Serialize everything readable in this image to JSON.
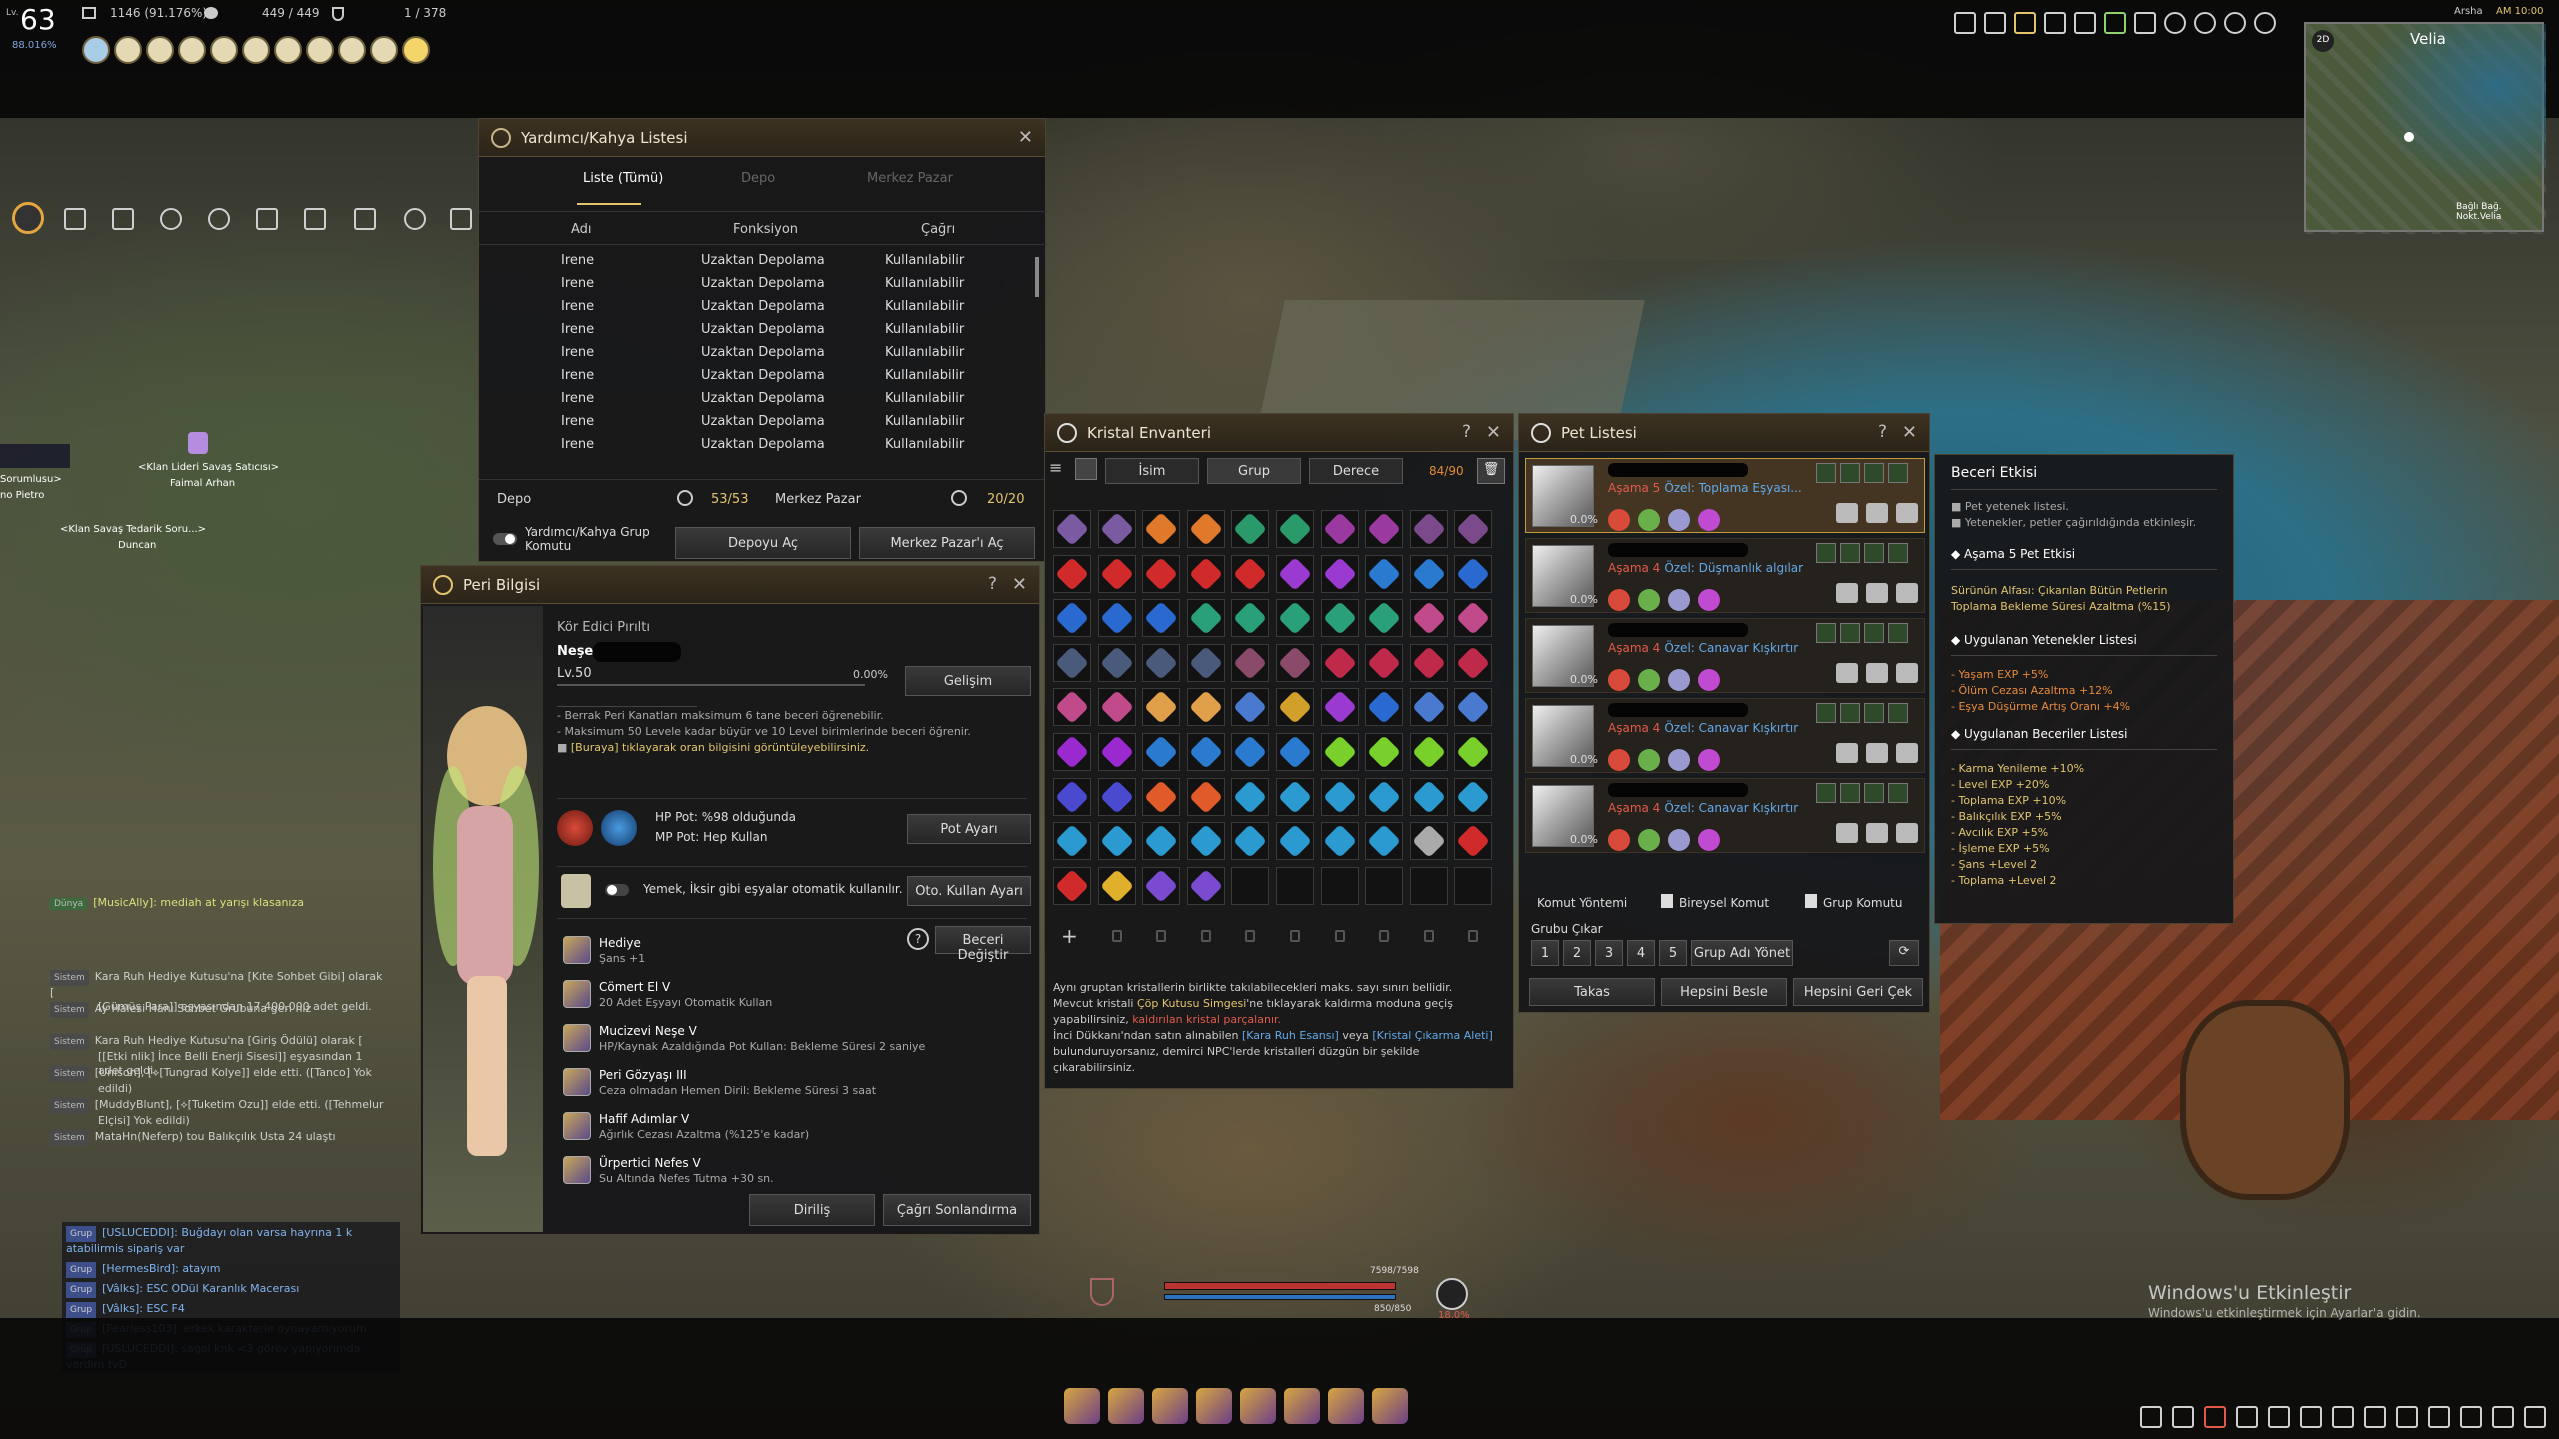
{
  "hud": {
    "level_label": "Lv.",
    "level": "63",
    "level_pct": "88.016%",
    "ap": "1146 (91.176%)",
    "weight": "449 / 449",
    "energy": "1 / 378",
    "region": "Velia",
    "server": "Arsha",
    "time": "AM 10:00",
    "minimap_mode": "2D",
    "minimap_place": "Bağlı Bağ. Nokt.Velia",
    "hp_text": "7598/7598",
    "mp_text": "850/850",
    "xp_pct": "18.0%"
  },
  "npc": {
    "sieger_title": "<Klan Lideri Savaş Satıcısı>",
    "sieger_name": "Faimal Arhan",
    "supply_title": "<Klan Savaş Tedarik Soru...>",
    "supply_name": "Duncan",
    "left_title": "Sorumlusu>",
    "left_name": "no Pietro"
  },
  "helper": {
    "title": "Yardımcı/Kahya Listesi",
    "tabs": [
      "Liste (Tümü)",
      "Depo",
      "Merkez Pazar"
    ],
    "cols": [
      "Adı",
      "Fonksiyon",
      "Çağrı"
    ],
    "rows": [
      [
        "Irene",
        "Uzaktan Depolama",
        "Kullanılabilir"
      ],
      [
        "Irene",
        "Uzaktan Depolama",
        "Kullanılabilir"
      ],
      [
        "Irene",
        "Uzaktan Depolama",
        "Kullanılabilir"
      ],
      [
        "Irene",
        "Uzaktan Depolama",
        "Kullanılabilir"
      ],
      [
        "Irene",
        "Uzaktan Depolama",
        "Kullanılabilir"
      ],
      [
        "Irene",
        "Uzaktan Depolama",
        "Kullanılabilir"
      ],
      [
        "Irene",
        "Uzaktan Depolama",
        "Kullanılabilir"
      ],
      [
        "Irene",
        "Uzaktan Depolama",
        "Kullanılabilir"
      ],
      [
        "Irene",
        "Uzaktan Depolama",
        "Kullanılabilir"
      ]
    ],
    "depo_label": "Depo",
    "depo_count": "53/53",
    "market_label": "Merkez Pazar",
    "market_count": "20/20",
    "group_cmd": "Yardımcı/Kahya Grup Komutu",
    "open_depo": "Depoyu Aç",
    "open_market": "Merkez Pazar'ı Aç"
  },
  "fairy": {
    "title": "Peri Bilgisi",
    "type": "Kör Edici Pırıltı",
    "name": "Neşe",
    "level": "Lv.50",
    "exp": "0.00%",
    "grow_btn": "Gelişim",
    "notes": [
      "- Berrak Peri Kanatları maksimum 6 tane beceri öğrenebilir.",
      "- Maksimum 50 Levele kadar büyür ve 10 Level birimlerinde beceri öğrenir.",
      "[Buraya] tıklayarak oran bilgisini görüntüleyebilirsiniz."
    ],
    "hp_pot": "HP Pot: %98 olduğunda",
    "mp_pot": "MP Pot: Hep Kullan",
    "pot_btn": "Pot Ayarı",
    "auto_text": "Yemek, İksir gibi eşyalar otomatik kullanılır.",
    "auto_btn": "Oto. Kullan Ayarı",
    "skill_change": "Beceri Değiştir",
    "skills": [
      {
        "name": "Hediye",
        "desc": "Şans +1"
      },
      {
        "name": "Cömert El V",
        "desc": "20 Adet Eşyayı Otomatik Kullan"
      },
      {
        "name": "Mucizevi Neşe V",
        "desc": "HP/Kaynak Azaldığında Pot Kullan: Bekleme Süresi 2 saniye"
      },
      {
        "name": "Peri Gözyaşı III",
        "desc": "Ceza olmadan Hemen Diril: Bekleme Süresi 3 saat"
      },
      {
        "name": "Hafif Adımlar V",
        "desc": "Ağırlık Cezası Azaltma (%125'e kadar)"
      },
      {
        "name": "Ürpertici Nefes V",
        "desc": "Su Altında Nefes Tutma +30 sn."
      }
    ],
    "revive_btn": "Diriliş",
    "end_btn": "Çağrı Sonlandırma"
  },
  "crystal": {
    "title": "Kristal Envanteri",
    "sort": [
      "İsim",
      "Grup",
      "Derece"
    ],
    "count": "84/90",
    "info": [
      "Aynı gruptan kristallerin birlikte takılabilecekleri maks. sayı sınırı bellidir.",
      "Mevcut kristali ",
      "Çöp Kutusu Simgesi",
      "'ne tıklayarak kaldırma moduna geçiş yapabilirsiniz, ",
      "kaldırılan kristal parçalanır.",
      "İnci Dükkanı'ndan satın alınabilen ",
      "[Kara Ruh Esansı]",
      " veya ",
      "[Kristal Çıkarma Aleti]",
      " bulunduruyorsanız, demirci NPC'lerde kristalleri düzgün bir şekilde çıkarabilirsiniz."
    ]
  },
  "pets": {
    "title": "Pet Listesi",
    "items": [
      {
        "stage": "Aşama 5",
        "skill": "Özel: Toplama Eşyası...",
        "pct": "0.0%"
      },
      {
        "stage": "Aşama 4",
        "skill": "Özel: Düşmanlık algılar",
        "pct": "0.0%"
      },
      {
        "stage": "Aşama 4",
        "skill": "Özel: Canavar Kışkırtır",
        "pct": "0.0%"
      },
      {
        "stage": "Aşama 4",
        "skill": "Özel: Canavar Kışkırtır",
        "pct": "0.0%"
      },
      {
        "stage": "Aşama 4",
        "skill": "Özel: Canavar Kışkırtır",
        "pct": "0.0%"
      }
    ],
    "tabs": [
      "Komut Yöntemi",
      "Bireysel Komut",
      "Grup Komutu"
    ],
    "group_label": "Grubu Çıkar",
    "group_nums": [
      "1",
      "2",
      "3",
      "4",
      "5"
    ],
    "group_manage": "Grup Adı Yönet",
    "exchange": "Takas",
    "feed_all": "Hepsini Besle",
    "recall_all": "Hepsini Geri Çek"
  },
  "skill_effect": {
    "title": "Beceri Etkisi",
    "intro": [
      "Pet yetenek listesi.",
      "Yetenekler, petler çağırıldığında etkinleşir."
    ],
    "stage_header": "Aşama 5 Pet Etkisi",
    "stage_lines": [
      "Sürünün Alfası: Çıkarılan Bütün Petlerin",
      "Toplama Bekleme Süresi Azaltma (%15)"
    ],
    "applied_header": "Uygulanan Yetenekler Listesi",
    "applied": [
      "- Yaşam EXP +5%",
      "- Ölüm Cezası Azaltma +12%",
      "- Eşya Düşürme Artış Oranı +4%"
    ],
    "skills_header": "Uygulanan Beceriler Listesi",
    "skills": [
      "- Karma Yenileme +10%",
      "- Level EXP +20%",
      "- Toplama EXP +10%",
      "- Balıkçılık EXP +5%",
      "- Avcılık EXP +5%",
      "- İşleme EXP +5%",
      "- Şans +Level 2",
      "- Toplama +Level 2"
    ]
  },
  "chat": {
    "world_tag": "Dünya",
    "world_msg": "[MusicAlly]: mediah at yarışı klasanıza",
    "sys": [
      [
        "Kara Ruh Hediye Kutusu'na [Kıte Sohbet Gibi] olarak [",
        "[Gümüş Para]] eşyasından 17.400.000 adet geldi."
      ],
      [
        "Ay Halesi Hanı Sohbet Grubuna geri niz",
        ""
      ],
      [
        "Kara Ruh Hediye Kutusu'na [Giriş Ödülü] olarak [",
        "[[Etki nlik] İnce Belli Enerji Sisesi]] eşyasından 1 adet geldi."
      ],
      [
        "[Unison], [⟡[Tungrad Kolye]] elde etti. ([Tanco] Yok",
        "edildi)"
      ],
      [
        "[MuddyBlunt], [⟡[Tuketim Ozu]] elde etti. ([Tehmelur",
        "Elçisi] Yok edildi)"
      ],
      [
        "MataHn(Neferp) tou Balıkçılık Usta 24 ulaştı",
        ""
      ]
    ],
    "sys_tag": "Sistem",
    "grp_tag": "Grup",
    "grp": [
      "[USLUCEDDI]: Buğdayı olan varsa hayrına 1 k atabilirmis sipariş var",
      "[HermesBird]: atayım",
      "[Vâlks]: ESC ODül Karanlık Macerası",
      "[Vâlks]: ESC F4",
      "[Fearless103]: erkek karakterle oynayamıyorum",
      "[USLUCEDDI]: sagol knk <3 görev yapıyorımda verdim tvD"
    ]
  },
  "windows": {
    "line1": "Windows'u Etkinleştir",
    "line2": "Windows'u etkinleştirmek için Ayarlar'a gidin."
  }
}
